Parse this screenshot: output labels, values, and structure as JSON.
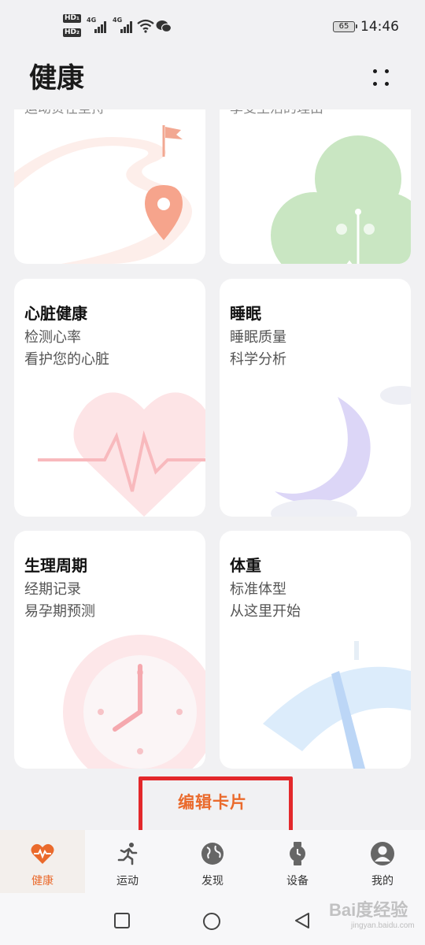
{
  "status_bar": {
    "hd1": "HD₁",
    "hd2": "HD₂",
    "net1": "4G",
    "net2": "4G",
    "battery": "65",
    "time": "14:46"
  },
  "header": {
    "title": "健康"
  },
  "cards": {
    "top_left_cut": "运动贵在坚持",
    "top_right_cut": "享受生活的理由",
    "heart": {
      "title": "心脏健康",
      "line1": "检测心率",
      "line2": "看护您的心脏"
    },
    "sleep": {
      "title": "睡眠",
      "line1": "睡眠质量",
      "line2": "科学分析"
    },
    "cycle": {
      "title": "生理周期",
      "line1": "经期记录",
      "line2": "易孕期预测"
    },
    "weight": {
      "title": "体重",
      "line1": "标准体型",
      "line2": "从这里开始"
    }
  },
  "edit_cards_label": "编辑卡片",
  "bottom_nav": {
    "items": [
      {
        "label": "健康",
        "icon": "heart-pulse-icon",
        "active": true
      },
      {
        "label": "运动",
        "icon": "runner-icon",
        "active": false
      },
      {
        "label": "发现",
        "icon": "globe-icon",
        "active": false
      },
      {
        "label": "设备",
        "icon": "watch-icon",
        "active": false
      },
      {
        "label": "我的",
        "icon": "user-icon",
        "active": false
      }
    ]
  },
  "watermark": {
    "main": "Bai度经验",
    "sub": "jingyan.baidu.com"
  },
  "colors": {
    "accent": "#ea6a2c",
    "highlight_box": "#e3282b",
    "background": "#f1f1f3"
  }
}
